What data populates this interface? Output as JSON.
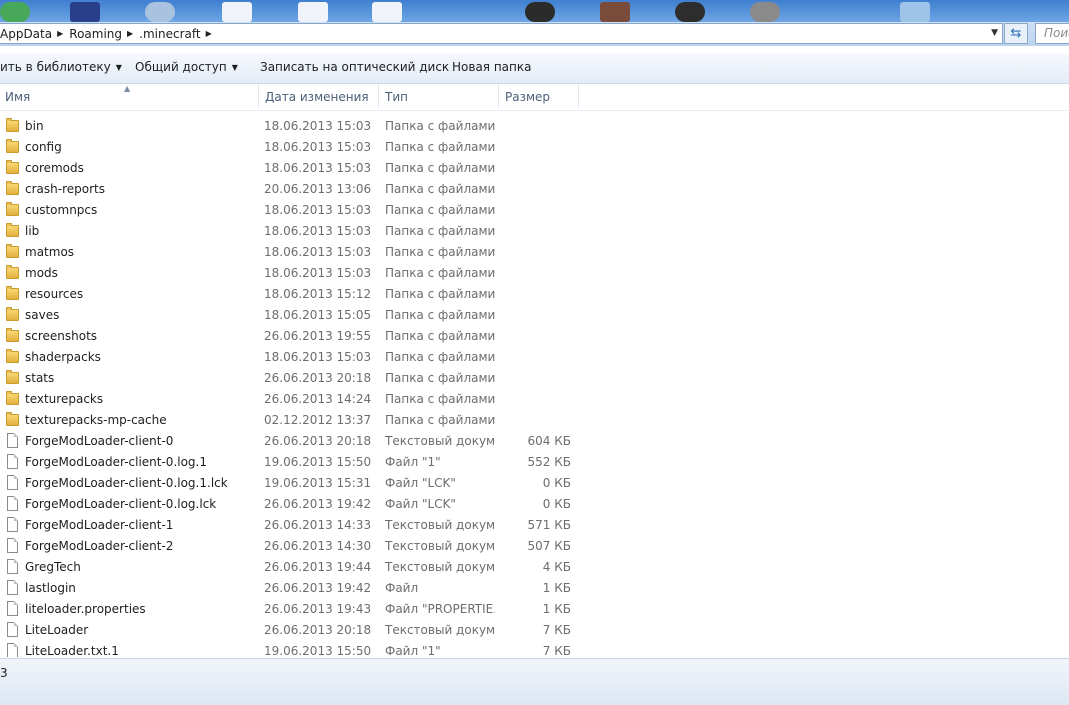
{
  "address": {
    "crumbs": [
      "AppData",
      "Roaming",
      ".minecraft"
    ]
  },
  "search": {
    "placeholder": "Поиск"
  },
  "toolbar": {
    "library_label": "ить в библиотеку",
    "share_label": "Общий доступ",
    "burn_label": "Записать на оптический диск",
    "new_folder_label": "Новая папка"
  },
  "columns": {
    "name": "Имя",
    "date": "Дата изменения",
    "type": "Тип",
    "size": "Размер"
  },
  "files": [
    {
      "name": "bin",
      "date": "18.06.2013 15:03",
      "type": "Папка с файлами",
      "size": "",
      "kind": "folder"
    },
    {
      "name": "config",
      "date": "18.06.2013 15:03",
      "type": "Папка с файлами",
      "size": "",
      "kind": "folder"
    },
    {
      "name": "coremods",
      "date": "18.06.2013 15:03",
      "type": "Папка с файлами",
      "size": "",
      "kind": "folder"
    },
    {
      "name": "crash-reports",
      "date": "20.06.2013 13:06",
      "type": "Папка с файлами",
      "size": "",
      "kind": "folder"
    },
    {
      "name": "customnpcs",
      "date": "18.06.2013 15:03",
      "type": "Папка с файлами",
      "size": "",
      "kind": "folder"
    },
    {
      "name": "lib",
      "date": "18.06.2013 15:03",
      "type": "Папка с файлами",
      "size": "",
      "kind": "folder"
    },
    {
      "name": "matmos",
      "date": "18.06.2013 15:03",
      "type": "Папка с файлами",
      "size": "",
      "kind": "folder"
    },
    {
      "name": "mods",
      "date": "18.06.2013 15:03",
      "type": "Папка с файлами",
      "size": "",
      "kind": "folder"
    },
    {
      "name": "resources",
      "date": "18.06.2013 15:12",
      "type": "Папка с файлами",
      "size": "",
      "kind": "folder"
    },
    {
      "name": "saves",
      "date": "18.06.2013 15:05",
      "type": "Папка с файлами",
      "size": "",
      "kind": "folder"
    },
    {
      "name": "screenshots",
      "date": "26.06.2013 19:55",
      "type": "Папка с файлами",
      "size": "",
      "kind": "folder"
    },
    {
      "name": "shaderpacks",
      "date": "18.06.2013 15:03",
      "type": "Папка с файлами",
      "size": "",
      "kind": "folder"
    },
    {
      "name": "stats",
      "date": "26.06.2013 20:18",
      "type": "Папка с файлами",
      "size": "",
      "kind": "folder"
    },
    {
      "name": "texturepacks",
      "date": "26.06.2013 14:24",
      "type": "Папка с файлами",
      "size": "",
      "kind": "folder"
    },
    {
      "name": "texturepacks-mp-cache",
      "date": "02.12.2012 13:37",
      "type": "Папка с файлами",
      "size": "",
      "kind": "folder"
    },
    {
      "name": "ForgeModLoader-client-0",
      "date": "26.06.2013 20:18",
      "type": "Текстовый докум...",
      "size": "604 КБ",
      "kind": "file"
    },
    {
      "name": "ForgeModLoader-client-0.log.1",
      "date": "19.06.2013 15:50",
      "type": "Файл \"1\"",
      "size": "552 КБ",
      "kind": "file"
    },
    {
      "name": "ForgeModLoader-client-0.log.1.lck",
      "date": "19.06.2013 15:31",
      "type": "Файл \"LCK\"",
      "size": "0 КБ",
      "kind": "file"
    },
    {
      "name": "ForgeModLoader-client-0.log.lck",
      "date": "26.06.2013 19:42",
      "type": "Файл \"LCK\"",
      "size": "0 КБ",
      "kind": "file"
    },
    {
      "name": "ForgeModLoader-client-1",
      "date": "26.06.2013 14:33",
      "type": "Текстовый докум...",
      "size": "571 КБ",
      "kind": "file"
    },
    {
      "name": "ForgeModLoader-client-2",
      "date": "26.06.2013 14:30",
      "type": "Текстовый докум...",
      "size": "507 КБ",
      "kind": "file"
    },
    {
      "name": "GregTech",
      "date": "26.06.2013 19:44",
      "type": "Текстовый докум...",
      "size": "4 КБ",
      "kind": "file"
    },
    {
      "name": "lastlogin",
      "date": "26.06.2013 19:42",
      "type": "Файл",
      "size": "1 КБ",
      "kind": "file"
    },
    {
      "name": "liteloader.properties",
      "date": "26.06.2013 19:43",
      "type": "Файл \"PROPERTIE...",
      "size": "1 КБ",
      "kind": "file"
    },
    {
      "name": "LiteLoader",
      "date": "26.06.2013 20:18",
      "type": "Текстовый докум...",
      "size": "7 КБ",
      "kind": "file"
    },
    {
      "name": "LiteLoader.txt.1",
      "date": "19.06.2013 15:50",
      "type": "Файл \"1\"",
      "size": "7 КБ",
      "kind": "file"
    }
  ],
  "status": {
    "text": "3"
  },
  "colors": {
    "accent": "#3f7fcf",
    "folder": "#e9c055"
  }
}
